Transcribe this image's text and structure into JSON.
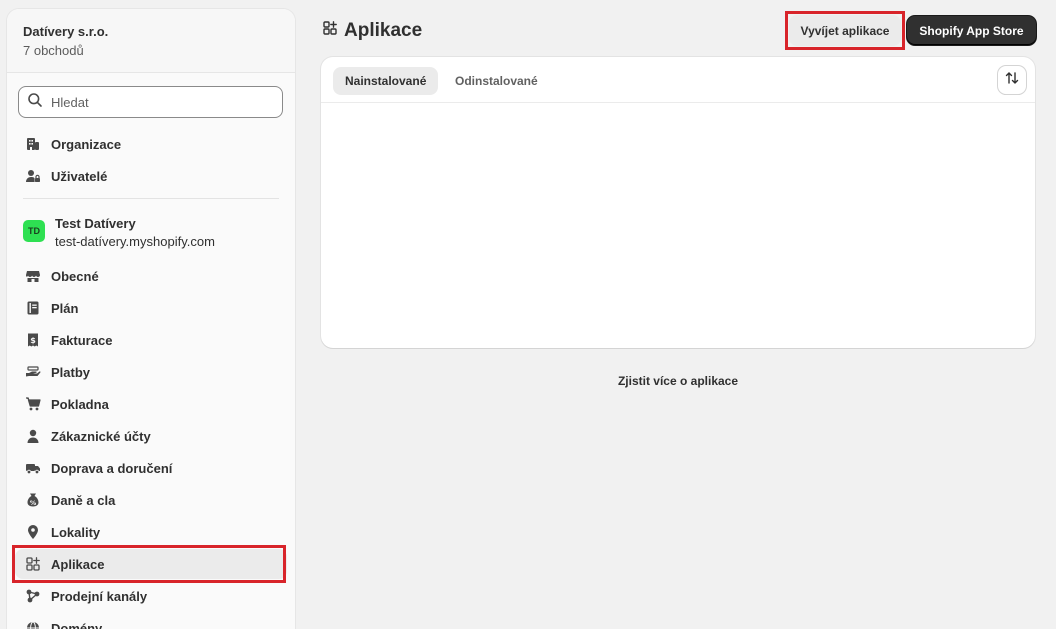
{
  "sidebar": {
    "org_name": "Datívery s.r.o.",
    "org_subtitle": "7 obchodů",
    "search_placeholder": "Hledat",
    "top_items": [
      {
        "label": "Organizace",
        "icon": "building-icon"
      },
      {
        "label": "Uživatelé",
        "icon": "users-lock-icon"
      }
    ],
    "store": {
      "avatar_initials": "TD",
      "name": "Test Datívery",
      "domain": "test-datívery.myshopify.com",
      "avatar_color": "#2ee052"
    },
    "settings_items": [
      {
        "label": "Obecné",
        "icon": "store-icon"
      },
      {
        "label": "Plán",
        "icon": "plan-icon"
      },
      {
        "label": "Fakturace",
        "icon": "receipt-icon"
      },
      {
        "label": "Platby",
        "icon": "payments-icon"
      },
      {
        "label": "Pokladna",
        "icon": "cart-icon"
      },
      {
        "label": "Zákaznické účty",
        "icon": "person-icon"
      },
      {
        "label": "Doprava a doručení",
        "icon": "truck-icon"
      },
      {
        "label": "Daně a cla",
        "icon": "tax-icon"
      },
      {
        "label": "Lokality",
        "icon": "location-icon"
      },
      {
        "label": "Aplikace",
        "icon": "apps-icon",
        "active": true
      },
      {
        "label": "Prodejní kanály",
        "icon": "channels-icon"
      },
      {
        "label": "Domény",
        "icon": "globe-icon"
      }
    ]
  },
  "header": {
    "title": "Aplikace",
    "develop_button": "Vyvíjet aplikace",
    "app_store_button": "Shopify App Store"
  },
  "card": {
    "tabs": [
      {
        "label": "Nainstalované",
        "selected": true
      },
      {
        "label": "Odinstalované",
        "selected": false
      }
    ]
  },
  "footer_link": "Zjistit více o aplikace",
  "colors": {
    "highlight": "#d8242a",
    "primary_button": "#303030",
    "background": "#f1f1f1"
  }
}
